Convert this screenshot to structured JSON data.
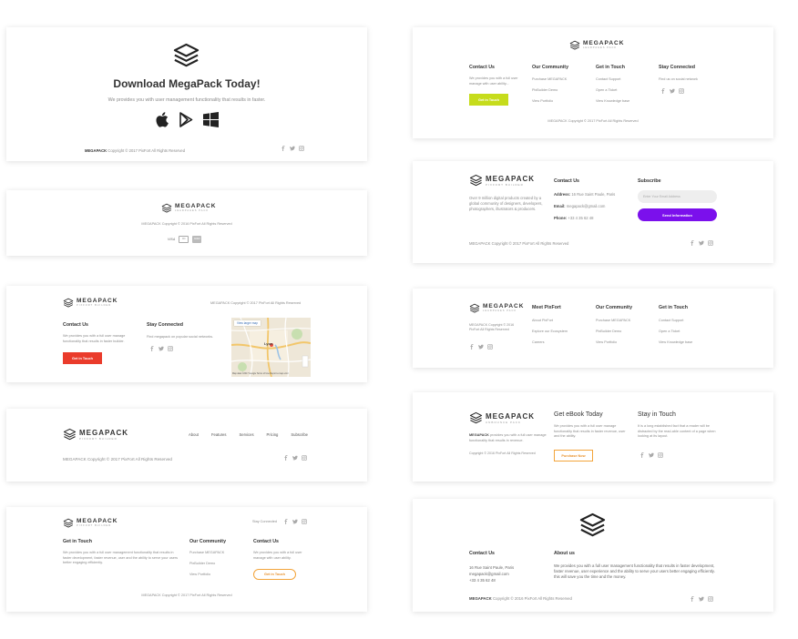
{
  "brand": {
    "name": "MEGAPACK",
    "tagline": "UNBOUNCE PACK",
    "tagline_alt": "LEADPAGES PACK",
    "tagline_builder": "PIXFORT BUILDER"
  },
  "colors": {
    "lime": "#c6dc1c",
    "red": "#ea3b2b",
    "purple": "#7b10ec",
    "orange": "#f3a43a",
    "text": "#333333",
    "muted": "#888888"
  },
  "card1": {
    "title": "Download MegaPack Today!",
    "subtitle": "We provides you with user management functionality that results in faster.",
    "copyright_brand": "MEGAPACK",
    "copyright": "Copyright © 2017 PixFort All Rights Reserved",
    "stores": [
      "apple-icon",
      "google-play-icon",
      "windows-icon"
    ]
  },
  "card2": {
    "copyright": "MEGAPACK Copyright © 2016 PixFort All Rights Reserved",
    "payments": [
      "VISA",
      "MC",
      "AMEX"
    ]
  },
  "card3": {
    "copyright": "MEGAPACK Copyright © 2017 PixFort All Rights Reserved",
    "contact_title": "Contact Us",
    "contact_text": "We provides you with a full user manage functionality that results in faster builder.",
    "button": "Get in Touch",
    "stay_title": "Stay Connected",
    "stay_text": "Find megapack on popular social networks.",
    "map_link": "View larger map",
    "map_city": "Lyon",
    "map_footer": "Map data ©2017 Google  Terms of Use  Report a map error"
  },
  "card4": {
    "nav": [
      "About",
      "Features",
      "Services",
      "Pricing",
      "Subscribe"
    ],
    "copyright": "MEGAPACK Copyright © 2017 PixFort All Rights Reserved"
  },
  "card5": {
    "stay": "Stay Connected",
    "col1_title": "Get in Touch",
    "col1_text": "We provides you with a full user management functionality that results in faster development, faster revenue, user and the ability to serve your users better engaging efficiently.",
    "col2_title": "Our Community",
    "col2_links": [
      "Purchase MEGAPACK",
      "PixBuilder Demo",
      "View Portfolio"
    ],
    "col3_title": "Contact Us",
    "col3_text": "We provides you with a full user manage with user ability.",
    "button": "Get in Touch",
    "copyright": "MEGAPACK Copyright © 2017 PixFort All Rights Reserved"
  },
  "card6": {
    "col1_title": "Contact Us",
    "col1_text": "We provides you with a full user manage with user ability...",
    "button": "Get in Touch",
    "col2_title": "Our Community",
    "col2_links": [
      "Purchase MEGAPACK",
      "PixBuilder Demo",
      "View Portfolio"
    ],
    "col3_title": "Get in Touch",
    "col3_links": [
      "Contact Support",
      "Open a Ticket",
      "View Knowledge base"
    ],
    "col4_title": "Stay Connected",
    "col4_text": "Find us on social network",
    "copyright": "MEGAPACK Copyright © 2017 PixFort All Rights Reserved"
  },
  "card7": {
    "about": "Over 9 million digital products created by a global community of designers, developers, photographers, illustrators & producers.",
    "contact_title": "Contact Us",
    "address_label": "Address:",
    "address": "16 Rue Saint Paule, Paris",
    "email_label": "Email:",
    "email": "megapack@gmail.com",
    "phone_label": "Phone:",
    "phone": "+33 4 35 62 48",
    "subscribe_title": "Subscribe",
    "email_placeholder": "Enter Your Email Address",
    "button": "Send Information",
    "copyright": "MEGAPACK Copyright © 2017 PixFort All Rights Reserved"
  },
  "card8": {
    "copyright": "MEGAPACK Copyright © 2016 PixFort All Rights Reserved",
    "col1_title": "Meet PixFort",
    "col1_links": [
      "About PixFort",
      "Explore our Ecosystem",
      "Careers"
    ],
    "col2_title": "Our Community",
    "col2_links": [
      "Purchase MEGAPACK",
      "PixBuilder Demo",
      "View Portfolio"
    ],
    "col3_title": "Get in Touch",
    "col3_links": [
      "Contact Support",
      "Open a Ticket",
      "View Knowledge base"
    ]
  },
  "card9": {
    "brand_desc_bold": "MEGAPACK",
    "brand_desc": "provides you with a full user manage functionality that results in revenue.",
    "copyright": "Copyright © 2016 PixFort All Rights Reserved",
    "ebook_title": "Get eBook Today",
    "ebook_text": "We provides you with a full user manage functionality that results in faster revenue, user and the ability.",
    "button": "Purchase Now",
    "stay_title": "Stay in Touch",
    "stay_text": "It is a long established fact that a reader will be distracted by the read-able content of a page when looking at its layout."
  },
  "card10": {
    "contact_title": "Contact Us",
    "address": "16 Rue Saint Paule, Paris",
    "email": "megapack@gmail.com",
    "phone": "+33 4 35 62 48",
    "about_title": "About us",
    "about_text": "We provides you with a full user management functionality that results in faster development, faster revenue, user experience and the ability to serve your users better engaging efficiently. this will save you the time and the money.",
    "copyright_brand": "MEGAPACK",
    "copyright": "Copyright © 2016 PixFort All Rights Reserved"
  }
}
